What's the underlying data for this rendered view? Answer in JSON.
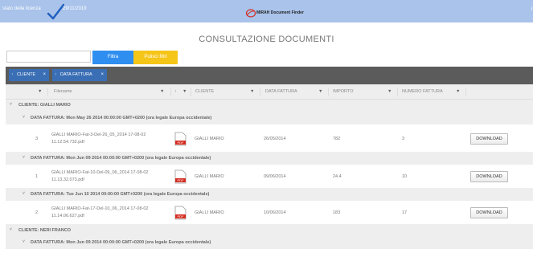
{
  "topbar": {
    "license_label": "stato della licenza",
    "license_date": "29/11/2019",
    "brand_name": "MIRAH Document Finder",
    "corner_glyph": "i"
  },
  "page_title": "CONSULTAZIONE DOCUMENTI",
  "filters": {
    "search_value": "",
    "filter_button": "Filtra",
    "clear_button": "Pulisci filtri"
  },
  "grouping": {
    "chips": [
      {
        "sort": "↑",
        "label": "CLIENTE",
        "remove": "×"
      },
      {
        "sort": "↑",
        "label": "DATA FATTURA",
        "remove": "×"
      }
    ]
  },
  "columns": [
    "Filename",
    "CLIENTE",
    "DATA FATTURA",
    "IMPORTO",
    "NUMERO FATTURA"
  ],
  "column_sort_glyph": "↑",
  "groups": [
    {
      "level": 1,
      "label": "CLIENTE: GIALLI MARIO"
    },
    {
      "level": 2,
      "label": "DATA FATTURA: Mon May 26 2014 00:00:00 GMT+0200 (ora legale Europa occidentale)"
    },
    {
      "level": 2,
      "label": "DATA FATTURA: Mon Jun 09 2014 00:00:00 GMT+0200 (ora legale Europa occidentale)"
    },
    {
      "level": 2,
      "label": "DATA FATTURA: Tue Jun 10 2014 00:00:00 GMT+0200 (ora legale Europa occidentale)"
    },
    {
      "level": 1,
      "label": "CLIENTE: NERI FRANCO"
    },
    {
      "level": 2,
      "label": "DATA FATTURA: Mon Jun 09 2014 00:00:00 GMT+0200 (ora legale Europa occidentale)"
    }
  ],
  "rows": [
    {
      "index": "3",
      "filename_line1": "GIALLI MARIO-Fat-3-Del-26_05_2014 17-08-02",
      "filename_line2": "11.12.54.732.pdf",
      "cliente": "GIALLI MARIO",
      "data": "26/05/2014",
      "importo": "782",
      "numero": "3",
      "download": "DOWNLOAD"
    },
    {
      "index": "1",
      "filename_line1": "GIALLI MARIO-Fat-10-Del-09_06_2014 17-08-02",
      "filename_line2": "11.13.32.073.pdf",
      "cliente": "GIALLI MARIO",
      "data": "09/06/2014",
      "importo": "24.4",
      "numero": "10",
      "download": "DOWNLOAD"
    },
    {
      "index": "2",
      "filename_line1": "GIALLI MARIO-Fat-17-Del-10_06_2014 17-08-02",
      "filename_line2": "11.14.06.627.pdf",
      "cliente": "GIALLI MARIO",
      "data": "10/06/2014",
      "importo": "183",
      "numero": "17",
      "download": "DOWNLOAD"
    }
  ],
  "pdf_label": "PDF",
  "filter_icon_glyph": "▼",
  "group_arrow_glyph": "˅",
  "colors": {
    "topbar": "#a9c3ea",
    "filter_button": "#2f8ff0",
    "clear_button": "#f5c518",
    "group_bar": "#5b5b5b",
    "chip": "#3a6fb5",
    "pdf_red": "#d42a1e"
  }
}
